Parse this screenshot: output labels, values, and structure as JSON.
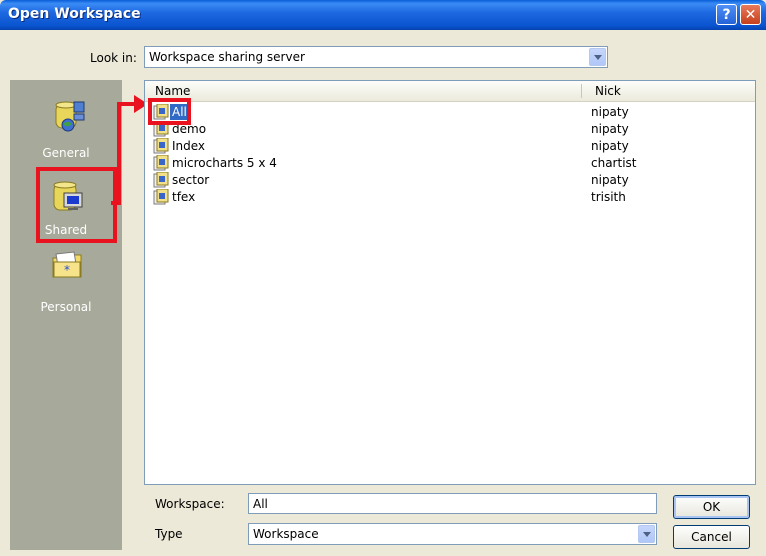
{
  "window": {
    "title": "Open Workspace",
    "help_glyph": "?",
    "close_glyph": "✕"
  },
  "lookin": {
    "label": "Look in:",
    "value": "Workspace sharing server"
  },
  "places": [
    {
      "label": "General",
      "icon": "general-icon"
    },
    {
      "label": "Shared",
      "icon": "shared-icon"
    },
    {
      "label": "Personal",
      "icon": "personal-icon"
    }
  ],
  "columns": {
    "name": "Name",
    "nick": "Nick"
  },
  "files": [
    {
      "name": "All",
      "nick": "nipaty"
    },
    {
      "name": "demo",
      "nick": "nipaty"
    },
    {
      "name": "Index",
      "nick": "nipaty"
    },
    {
      "name": "microcharts 5 x 4",
      "nick": "chartist"
    },
    {
      "name": "sector",
      "nick": "nipaty"
    },
    {
      "name": "tfex",
      "nick": "trisith"
    }
  ],
  "workspace": {
    "label": "Workspace:",
    "value": "All"
  },
  "type": {
    "label": "Type",
    "value": "Workspace"
  },
  "buttons": {
    "ok": "OK",
    "cancel": "Cancel"
  },
  "colors": {
    "highlight": "#e8131f",
    "selection": "#316ac5",
    "titlebar": "#0a55d0"
  }
}
